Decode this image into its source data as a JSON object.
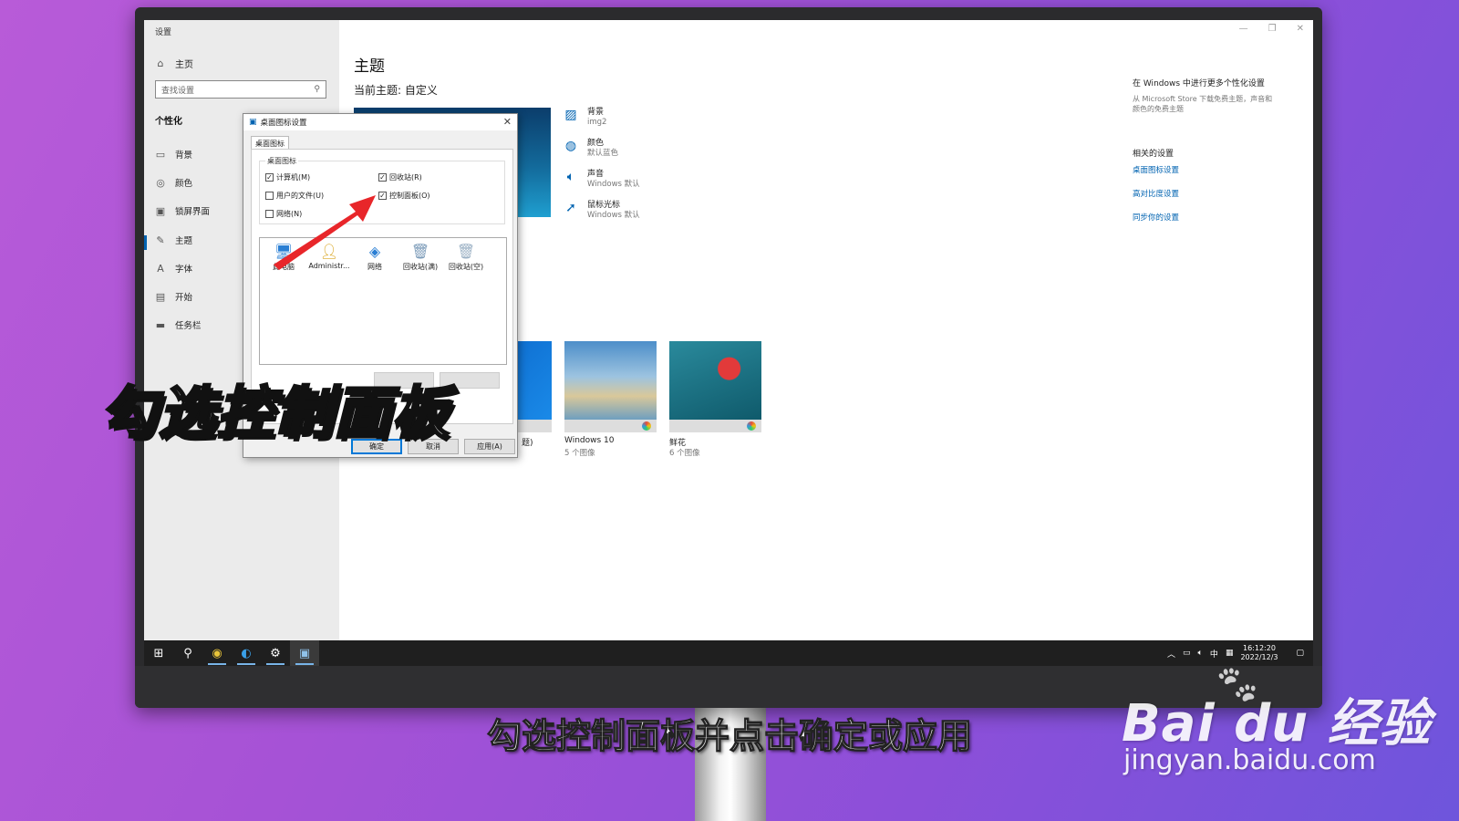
{
  "settings": {
    "window_title": "设置",
    "home_label": "主页",
    "search_placeholder": "查找设置",
    "category": "个性化",
    "items": [
      {
        "label": "背景",
        "icon": "image-icon"
      },
      {
        "label": "颜色",
        "icon": "palette-icon"
      },
      {
        "label": "锁屏界面",
        "icon": "lock-screen-icon"
      },
      {
        "label": "主题",
        "icon": "theme-icon"
      },
      {
        "label": "字体",
        "icon": "font-icon"
      },
      {
        "label": "开始",
        "icon": "start-icon"
      },
      {
        "label": "任务栏",
        "icon": "taskbar-icon"
      }
    ],
    "active_item": "主题"
  },
  "main": {
    "title": "主题",
    "current_theme": "当前主题: 自定义",
    "props": [
      {
        "title": "背景",
        "sub": "img2",
        "icon": "image-icon"
      },
      {
        "title": "颜色",
        "sub": "默认蓝色",
        "icon": "palette-icon"
      },
      {
        "title": "声音",
        "sub": "Windows 默认",
        "icon": "speaker-icon"
      },
      {
        "title": "鼠标光标",
        "sub": "Windows 默认",
        "icon": "cursor-icon"
      }
    ],
    "themes": [
      {
        "name": "题)",
        "sub": ""
      },
      {
        "name": "Windows 10",
        "sub": "5 个图像"
      },
      {
        "name": "鲜花",
        "sub": "6 个图像"
      }
    ],
    "right_panel": {
      "heading": "在 Windows 中进行更多个性化设置",
      "text": "从 Microsoft Store 下载免费主题，声音和颜色的免费主题",
      "related_heading": "相关的设置",
      "links": [
        "桌面图标设置",
        "高对比度设置",
        "同步你的设置"
      ]
    }
  },
  "dialog": {
    "title": "桌面图标设置",
    "tab": "桌面图标",
    "group_label": "桌面图标",
    "checkboxes": [
      {
        "label": "计算机(M)",
        "checked": true
      },
      {
        "label": "回收站(R)",
        "checked": true
      },
      {
        "label": "用户的文件(U)",
        "checked": false
      },
      {
        "label": "控制面板(O)",
        "checked": true
      },
      {
        "label": "网络(N)",
        "checked": false
      }
    ],
    "icons": [
      {
        "label": "此电脑",
        "icon": "computer-icon"
      },
      {
        "label": "Administr...",
        "icon": "user-folder-icon"
      },
      {
        "label": "网络",
        "icon": "network-icon"
      },
      {
        "label": "回收站(满)",
        "icon": "recycle-bin-full-icon"
      },
      {
        "label": "回收站(空)",
        "icon": "recycle-bin-empty-icon"
      }
    ],
    "buttons": {
      "ok": "确定",
      "cancel": "取消",
      "apply": "应用(A)"
    }
  },
  "taskbar": {
    "tray_ime": "中",
    "clock_time": "16:12:20",
    "clock_date": "2022/12/3"
  },
  "overlay": {
    "big_text": "勾选控制面板",
    "caption": "勾选控制面板并点击确定或应用"
  },
  "watermark": {
    "logo": "Bai du 经验",
    "url": "jingyan.baidu.com"
  },
  "colors": {
    "accent": "#0063b1",
    "arrow": "#e8262a"
  }
}
